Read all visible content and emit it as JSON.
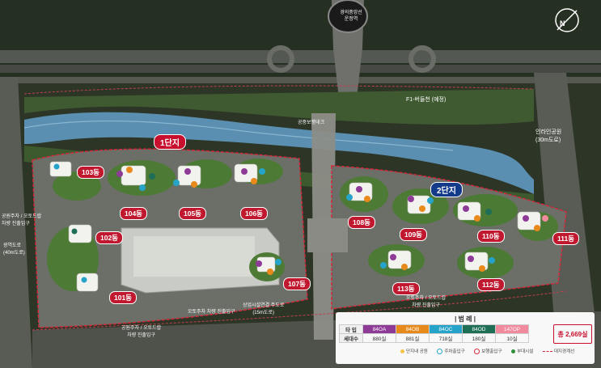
{
  "tunnel": {
    "line1": "경의중앙선",
    "line2": "운정역"
  },
  "zones": [
    {
      "label": "1단지",
      "style": "r"
    },
    {
      "label": "2단지",
      "style": "b"
    }
  ],
  "buildings_1": [
    {
      "label": "104동"
    },
    {
      "label": "105동"
    },
    {
      "label": "106동"
    },
    {
      "label": "103동"
    },
    {
      "label": "102동"
    },
    {
      "label": "101동"
    },
    {
      "label": "107동"
    }
  ],
  "buildings_2": [
    {
      "label": "108동"
    },
    {
      "label": "109동"
    },
    {
      "label": "110동"
    },
    {
      "label": "111동"
    },
    {
      "label": "112동"
    },
    {
      "label": "113동"
    }
  ],
  "roads": {
    "road_top": "F1-버들천",
    "road_top_note": "(예정)",
    "road_right": "인라인공원",
    "road_right_note": "(30m도로)",
    "road_left": "공원주차 / 오토드랍",
    "road_left2": "차량 진출입구",
    "road_left3": "광역도로",
    "road_left4": "(40m도로)",
    "bottom1": "오토주차 차량 진출입구",
    "bottom2": "상업시설연결 주도로",
    "bottom3": "(15m도로)",
    "bottom4": "오토주차 / 오토드랍",
    "bottom5": "차량 진출입구",
    "bottom6": "공원주차 / 오토드랍",
    "bottom7": "차량 진출입구",
    "bridge": "공중보행데크"
  },
  "legend": {
    "title": "| 범 례 |",
    "row1_head": "타 입",
    "row2_head": "세대수",
    "types": [
      "84OA",
      "84OB",
      "84OC",
      "84OD",
      "147OP"
    ],
    "counts": [
      "880실",
      "881실",
      "718실",
      "180실",
      "10실"
    ],
    "total": "총 2,669실",
    "key1": "단지내 공원",
    "key2": "주차출입구",
    "key3": "보행출입구",
    "key4": "부대시설",
    "key5": "대지경계선"
  },
  "colors": {
    "type_84OA": "#8e3b97",
    "type_84OB": "#e8891c",
    "type_84OC": "#26a3c8",
    "type_84OD": "#1f6f56",
    "type_147OP": "#f08a9c",
    "site_boundary": "#d2283a",
    "stream": "#6aa2c4"
  }
}
